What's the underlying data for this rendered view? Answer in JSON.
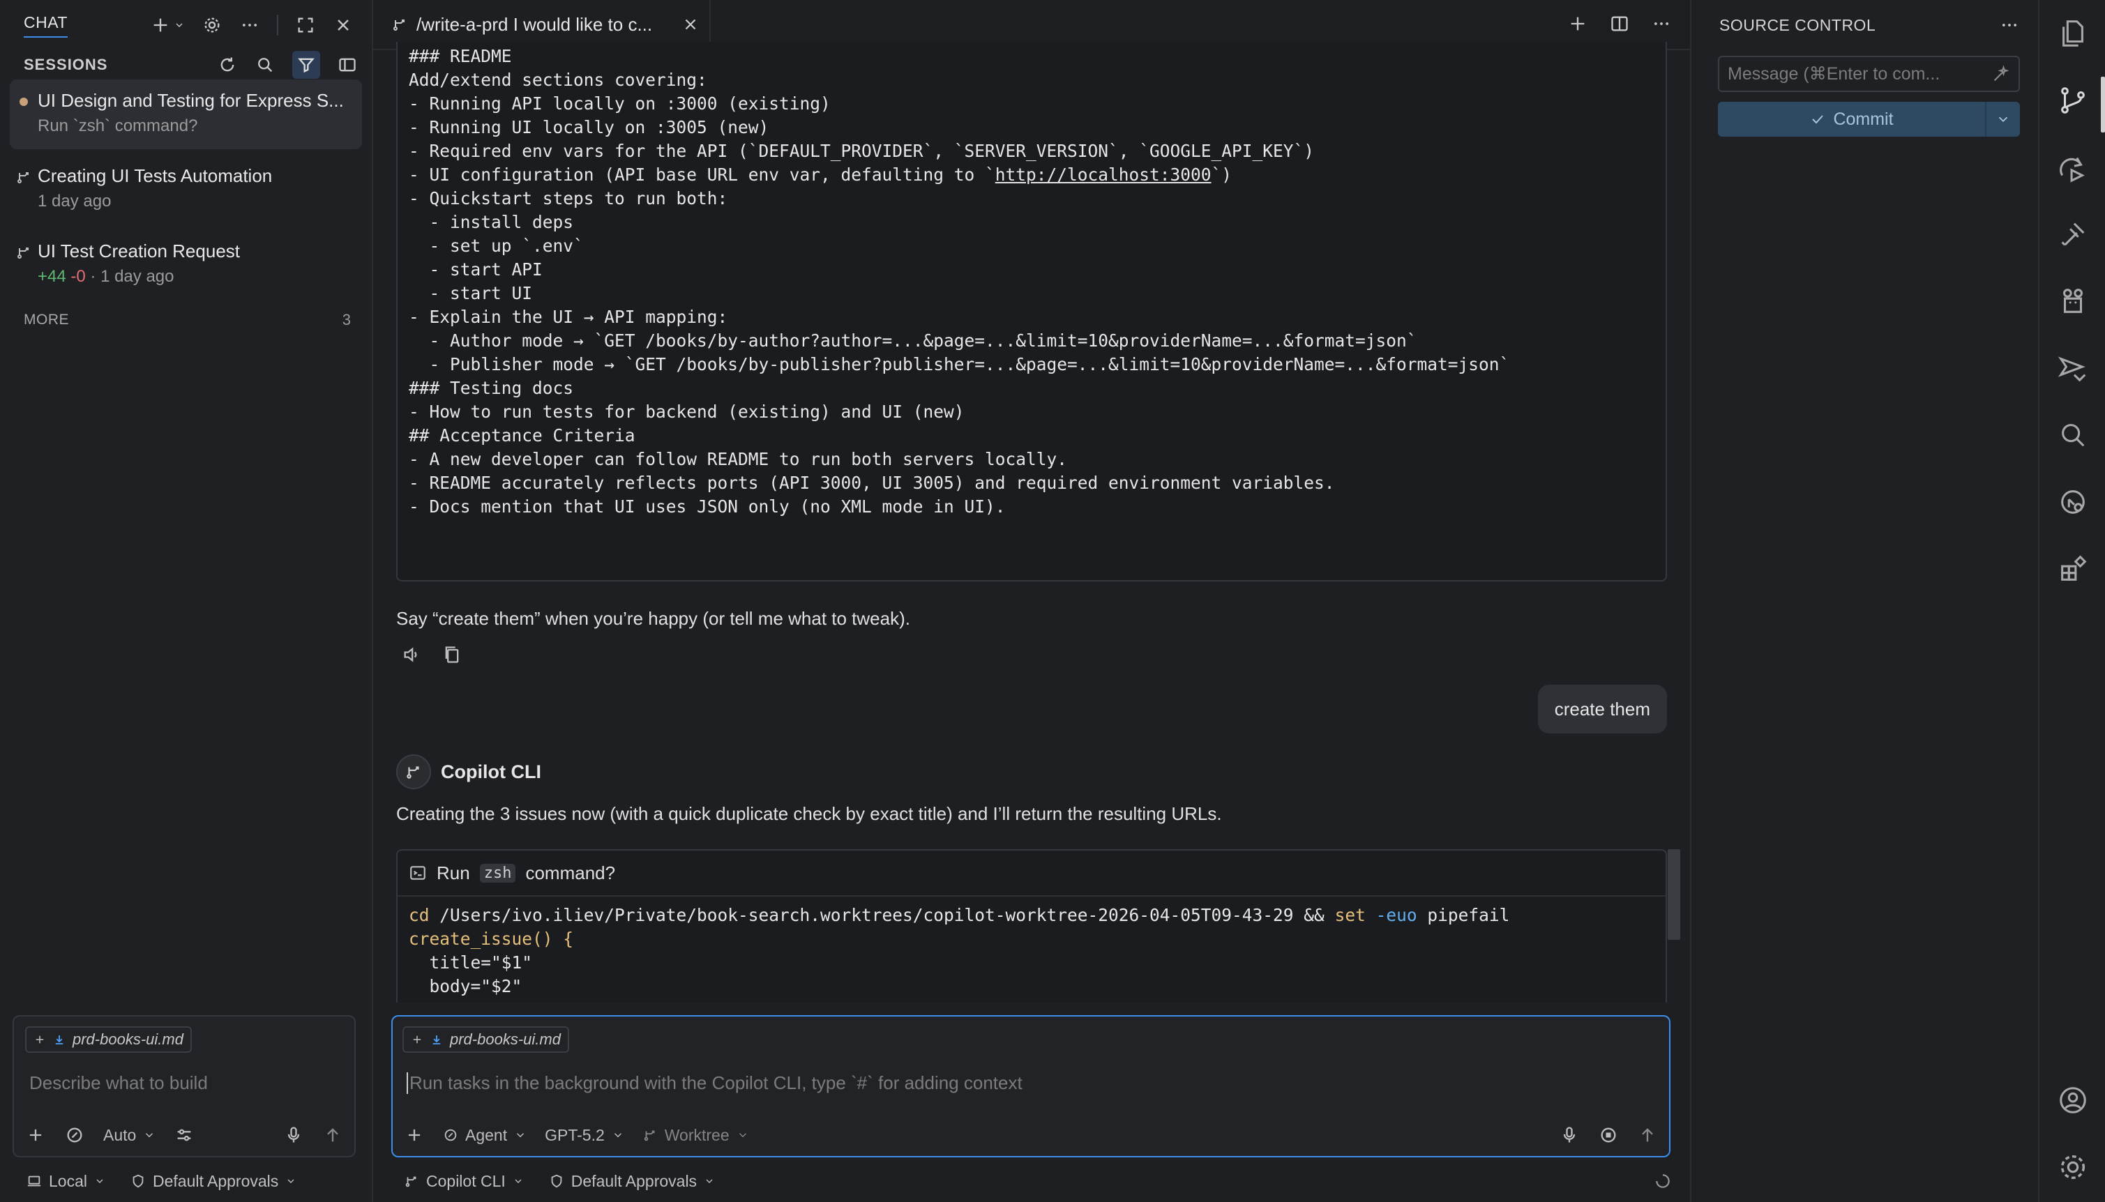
{
  "chat_panel": {
    "title": "CHAT",
    "sessions_label": "SESSIONS",
    "sessions": [
      {
        "title": "UI Design and Testing for Express S...",
        "subtitle": "Run `zsh` command?"
      },
      {
        "title": "Creating UI Tests Automation",
        "subtitle": "1 day ago"
      },
      {
        "title": "UI Test Creation Request",
        "added": "+44",
        "removed": "-0",
        "subtitle": "· 1 day ago"
      }
    ],
    "more_label": "MORE",
    "more_count": "3",
    "input": {
      "chip": "prd-books-ui.md",
      "placeholder": "Describe what to build",
      "mode": "Auto"
    },
    "status": {
      "location": "Local",
      "approvals": "Default Approvals"
    }
  },
  "editor": {
    "tab_title": "/write-a-prd I would like to c...",
    "code_top": [
      "### README",
      "Add/extend sections covering:",
      "- Running API locally on :3000 (existing)",
      "- Running UI locally on :3005 (new)",
      "- Required env vars for the API (`DEFAULT_PROVIDER`, `SERVER_VERSION`, `GOOGLE_API_KEY`)",
      "- Quickstart steps to run both:",
      "  - install deps",
      "  - set up `.env`",
      "  - start API",
      "  - start UI",
      "- Explain the UI → API mapping:",
      "  - Author mode → `GET /books/by-author?author=...&page=...&limit=10&providerName=...&format=json`",
      "  - Publisher mode → `GET /books/by-publisher?publisher=...&page=...&limit=10&providerName=...&format=json`",
      "",
      "### Testing docs",
      "- How to run tests for backend (existing) and UI (new)",
      "",
      "## Acceptance Criteria",
      "- A new developer can follow README to run both servers locally.",
      "- README accurately reflects ports (API 3000, UI 3005) and required environment variables.",
      "- Docs mention that UI uses JSON only (no XML mode in UI)."
    ],
    "ui_config_prefix": "- UI configuration (API base URL env var, defaulting to `",
    "ui_config_link": "http://localhost:3000",
    "ui_config_suffix": "`)",
    "assistant_msg": "Say “create them” when you’re happy (or tell me what to tweak).",
    "user_msg": "create them",
    "agent_name": "Copilot CLI",
    "agent_msg": "Creating the 3 issues now (with a quick duplicate check by exact title) and I’ll return the resulting URLs.",
    "run_block": {
      "prefix": "Run",
      "shell": "zsh",
      "suffix": "command?",
      "line1_cmd": "cd",
      "line1_path": " /Users/ivo.iliev/Private/book-search.worktrees/copilot-worktree-2026-04-05T09-43-29 ",
      "line1_and": "&& ",
      "line1_set": "set",
      "line1_flag": " -euo",
      "line1_rest": " pipefail",
      "line2": "create_issue() {",
      "line3": "  title=\"$1\"",
      "line4": "  body=\"$2\""
    },
    "input": {
      "chip": "prd-books-ui.md",
      "placeholder": "Run tasks in the background with the Copilot CLI, type `#` for adding context",
      "agent": "Agent",
      "model": "GPT-5.2",
      "worktree": "Worktree"
    },
    "status": {
      "cli": "Copilot CLI",
      "approvals": "Default Approvals"
    }
  },
  "source_control": {
    "title": "SOURCE CONTROL",
    "message_placeholder": "Message (⌘Enter to com...",
    "commit_label": "Commit"
  },
  "colors": {
    "accent": "#3b8eea",
    "added": "#5fb870",
    "removed": "#e36f6f",
    "commit_bg": "#2e4a62"
  }
}
